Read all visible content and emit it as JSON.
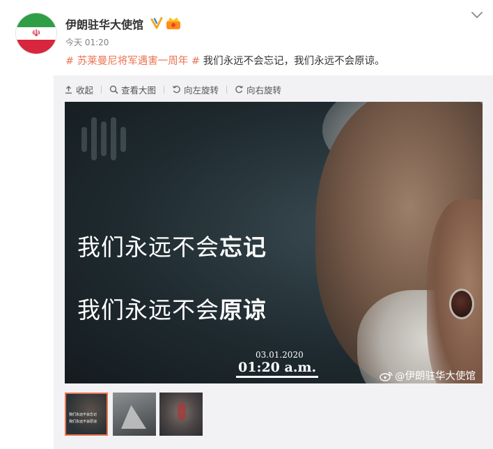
{
  "account": {
    "name": "伊朗驻华大使馆",
    "verified_icon": "verified-badge-icon",
    "vip_icon": "crown-badge-icon",
    "avatar": "iran-flag-avatar",
    "timestamp": "今天 01:20"
  },
  "post": {
    "topic": "# 苏莱曼尼将军遇害一周年 #",
    "text": " 我们永远不会忘记，我们永远不会原谅。"
  },
  "toolbar": {
    "collapse": "收起",
    "view_large": "查看大图",
    "rotate_left": "向左旋转",
    "rotate_right": "向右旋转"
  },
  "image": {
    "line1_normal": "我们永远不会",
    "line1_bold": "忘记",
    "line2_normal": "我们永远不会",
    "line2_bold": "原谅",
    "date": "03.01.2020",
    "time": "01:20 a.m.",
    "credit": "@伊朗驻华大使馆"
  },
  "thumbnails": {
    "t1_line1": "我们永远不会忘记",
    "t1_line2": "我们永远不会原谅"
  },
  "colors": {
    "topic": "#eb7350",
    "panel_bg": "#f2f2f5",
    "selected_border": "#eb7350",
    "verified": "#f5a623"
  }
}
